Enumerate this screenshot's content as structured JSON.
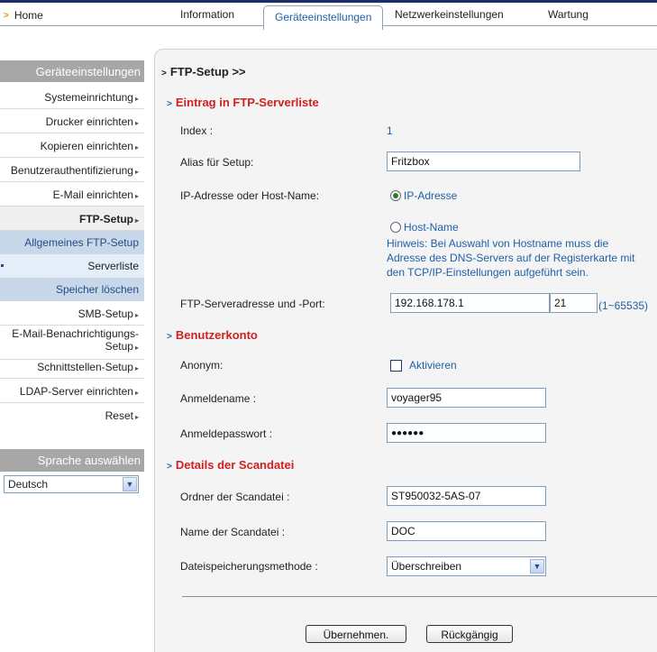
{
  "nav": {
    "home": "Home",
    "tabs": [
      "Information",
      "Geräteeinstellungen",
      "Netzwerkeinstellungen",
      "Wartung"
    ],
    "active_tab": "Geräteeinstellungen"
  },
  "sidebar": {
    "header": "Geräteeinstellungen",
    "items": [
      "Systemeinrichtung",
      "Drucker einrichten",
      "Kopieren einrichten",
      "Benutzerauthentifizierung",
      "E-Mail einrichten",
      "FTP-Setup"
    ],
    "sub_items": [
      "Allgemeines FTP-Setup",
      "Serverliste",
      "Speicher löschen"
    ],
    "items_after": [
      "SMB-Setup",
      "E-Mail-Benachrichtigungs-Setup",
      "Schnittstellen-Setup",
      "LDAP-Server einrichten",
      "Reset"
    ],
    "language_header": "Sprache auswählen",
    "language_value": "Deutsch"
  },
  "page": {
    "breadcrumb": "FTP-Setup >>",
    "section1": "Eintrag in FTP-Serverliste",
    "index_label": "Index :",
    "index_value": "1",
    "alias_label": "Alias für Setup:",
    "alias_value": "Fritzbox",
    "host_label": "IP-Adresse oder Host-Name:",
    "radio_ip": "IP-Adresse",
    "radio_host": "Host-Name",
    "hint": "Hinweis: Bei Auswahl von Hostname muss die Adresse des DNS-Servers auf der Registerkarte mit den TCP/IP-Einstellungen aufgeführt sein.",
    "server_label": "FTP-Serveradresse und -Port:",
    "server_value": "192.168.178.1",
    "port_value": "21",
    "port_range": "(1~65535)",
    "section2": "Benutzerkonto",
    "anon_label": "Anonym:",
    "anon_checkbox": "Aktivieren",
    "login_label": "Anmeldename :",
    "login_value": "voyager95",
    "password_label": "Anmeldepasswort :",
    "password_value": "●●●●●●",
    "section3": "Details der Scandatei",
    "folder_label": "Ordner der Scandatei :",
    "folder_value": "ST950032-5AS-07",
    "filename_label": "Name der Scandatei :",
    "filename_value": "DOC",
    "method_label": "Dateispeicherungsmethode :",
    "method_value": "Überschreiben",
    "apply_button": "Übernehmen.",
    "undo_button": "Rückgängig"
  }
}
